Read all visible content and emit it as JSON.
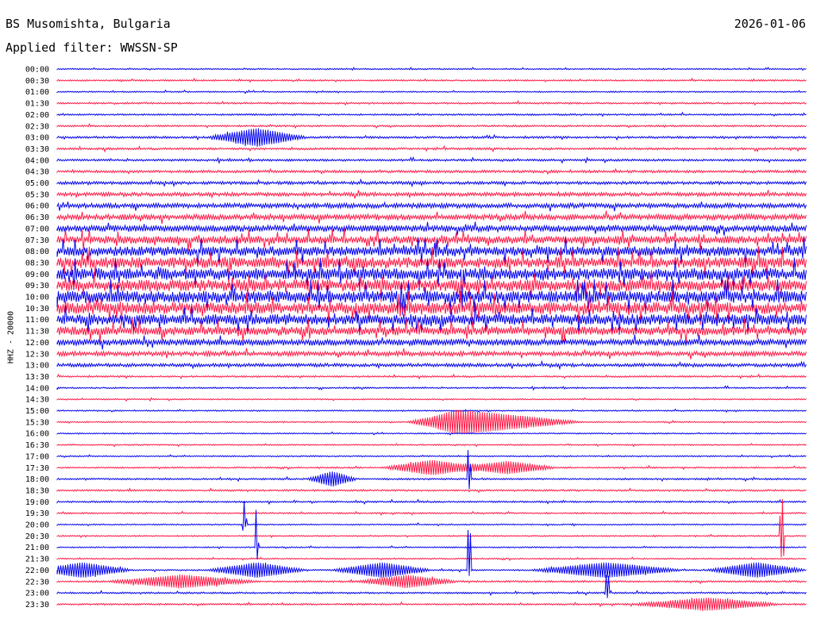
{
  "header": {
    "station": "BS Musomishta, Bulgaria",
    "date": "2026-01-06",
    "filter": "Applied filter: WWSSN-SP"
  },
  "chart_data": {
    "type": "line",
    "title": "BS Musomishta, Bulgaria",
    "date": "2026-01-06",
    "filter": "WWSSN-SP",
    "ylabel": "HHZ - 20000",
    "xlabel": "",
    "grid": false,
    "row_labels": [
      "00:00",
      "00:30",
      "01:00",
      "01:30",
      "02:00",
      "02:30",
      "03:00",
      "03:30",
      "04:00",
      "04:30",
      "05:00",
      "05:30",
      "06:00",
      "06:30",
      "07:00",
      "07:30",
      "08:00",
      "08:30",
      "09:00",
      "09:30",
      "10:00",
      "10:30",
      "11:00",
      "11:30",
      "12:00",
      "12:30",
      "13:00",
      "13:30",
      "14:00",
      "14:30",
      "15:00",
      "15:30",
      "16:00",
      "16:30",
      "17:00",
      "17:30",
      "18:00",
      "18:30",
      "19:00",
      "19:30",
      "20:00",
      "20:30",
      "21:00",
      "21:30",
      "22:00",
      "22:30",
      "23:00",
      "23:30"
    ],
    "colors": [
      "#0000ee",
      "#ff1744"
    ],
    "row_noise_level": [
      0.6,
      0.7,
      0.6,
      0.8,
      0.8,
      0.8,
      1.0,
      1.0,
      1.0,
      1.2,
      1.4,
      1.8,
      2.2,
      2.6,
      3.0,
      3.6,
      4.5,
      5.0,
      5.5,
      5.5,
      5.5,
      5.5,
      5.0,
      4.0,
      3.0,
      2.2,
      1.6,
      0.8,
      0.7,
      0.6,
      0.6,
      0.6,
      0.6,
      0.6,
      0.6,
      0.7,
      0.8,
      0.8,
      0.8,
      0.7,
      0.6,
      0.6,
      0.6,
      0.6,
      0.7,
      0.8,
      0.8,
      0.8
    ],
    "events": [
      {
        "row": 6,
        "minute": 8,
        "amplitude": 3.5,
        "duration_min": 2
      },
      {
        "row": 31,
        "minute": 16,
        "amplitude": 4,
        "duration_min": 2
      },
      {
        "row": 31,
        "minute": 18,
        "amplitude": 3,
        "duration_min": 3
      },
      {
        "row": 35,
        "minute": 15,
        "amplitude": 3,
        "duration_min": 2
      },
      {
        "row": 35,
        "minute": 18,
        "amplitude": 2.5,
        "duration_min": 2
      },
      {
        "row": 36,
        "minute": 11,
        "amplitude": 3,
        "duration_min": 1
      },
      {
        "row": 44,
        "minute": 1,
        "amplitude": 3,
        "duration_min": 2
      },
      {
        "row": 44,
        "minute": 8,
        "amplitude": 3,
        "duration_min": 2
      },
      {
        "row": 44,
        "minute": 13,
        "amplitude": 3,
        "duration_min": 2
      },
      {
        "row": 44,
        "minute": 22,
        "amplitude": 3,
        "duration_min": 3
      },
      {
        "row": 44,
        "minute": 28,
        "amplitude": 3,
        "duration_min": 2
      },
      {
        "row": 45,
        "minute": 5,
        "amplitude": 2.5,
        "duration_min": 3
      },
      {
        "row": 45,
        "minute": 14,
        "amplitude": 2.5,
        "duration_min": 2
      },
      {
        "row": 47,
        "minute": 26,
        "amplitude": 2.5,
        "duration_min": 3
      }
    ],
    "spikes": [
      {
        "row": 42,
        "minute": 8,
        "amplitude": 14
      },
      {
        "row": 40,
        "minute": 7.5,
        "amplitude": 12
      },
      {
        "row": 44,
        "minute": 16.5,
        "amplitude": 14
      },
      {
        "row": 36,
        "minute": 16.5,
        "amplitude": 10
      },
      {
        "row": 41,
        "minute": 29,
        "amplitude": 12
      },
      {
        "row": 46,
        "minute": 22,
        "amplitude": 6
      }
    ]
  }
}
